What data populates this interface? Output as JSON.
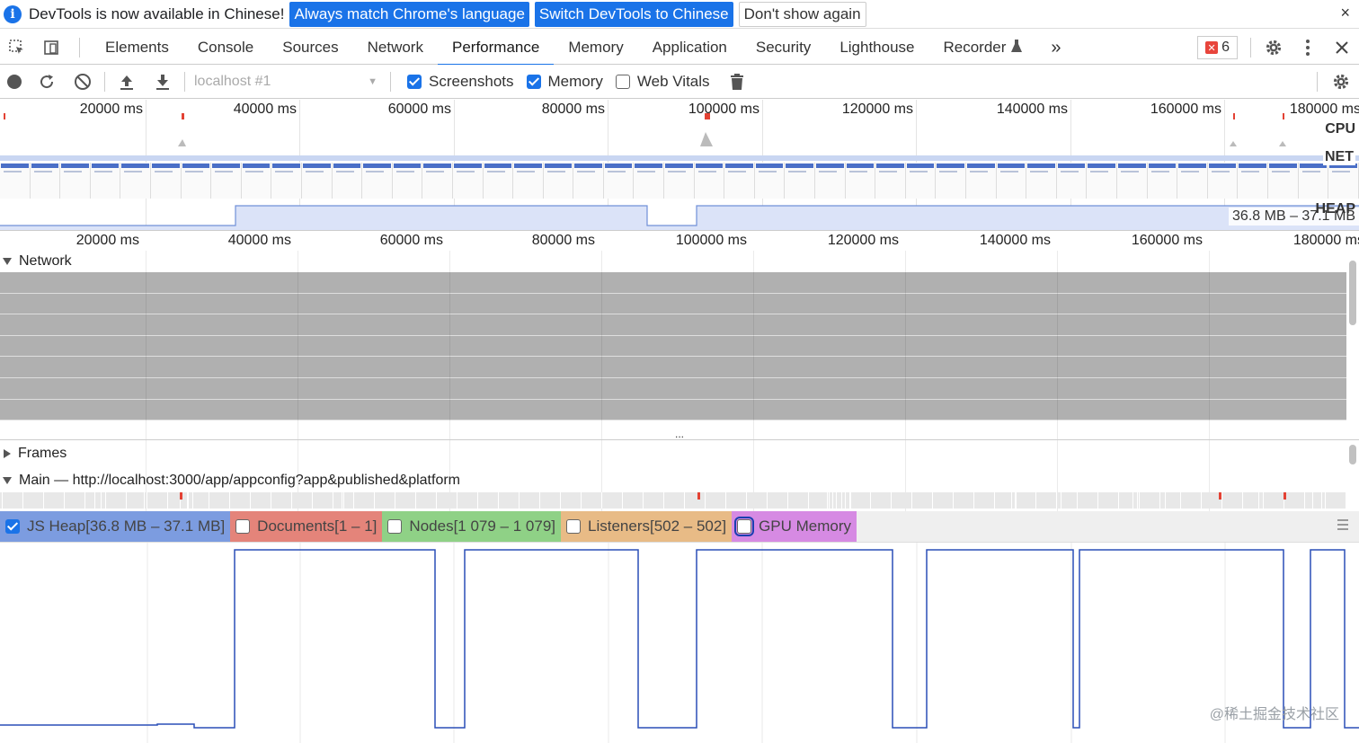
{
  "infobar": {
    "message": "DevTools is now available in Chinese!",
    "btn_match": "Always match Chrome's language",
    "btn_switch": "Switch DevTools to Chinese",
    "btn_dont_show": "Don't show again",
    "close": "×"
  },
  "tabs": [
    "Elements",
    "Console",
    "Sources",
    "Network",
    "Performance",
    "Memory",
    "Application",
    "Security",
    "Lighthouse",
    "Recorder"
  ],
  "active_tab": "Performance",
  "more_tabs": "»",
  "error_count": "6",
  "toolbar": {
    "profile_select": "localhost #1",
    "screenshots_label": "Screenshots",
    "memory_label": "Memory",
    "web_vitals_label": "Web Vitals"
  },
  "overview_ticks": [
    "20000 ms",
    "40000 ms",
    "60000 ms",
    "80000 ms",
    "100000 ms",
    "120000 ms",
    "140000 ms",
    "160000 ms",
    "180000 ms"
  ],
  "lane_labels": {
    "cpu": "CPU",
    "net": "NET",
    "heap": "HEAP"
  },
  "heap_range": "36.8 MB – 37.1 MB",
  "ruler_ticks": [
    "20000 ms",
    "40000 ms",
    "60000 ms",
    "80000 ms",
    "100000 ms",
    "120000 ms",
    "140000 ms",
    "160000 ms",
    "180000 ms"
  ],
  "tracks": {
    "network": "Network",
    "frames": "Frames",
    "main": "Main — http://localhost:3000/app/appconfig?app&published&platform"
  },
  "resizer": "...",
  "counters": [
    {
      "label": "JS Heap[36.8 MB – 37.1 MB]",
      "checked": true,
      "color": "#7c9ce0"
    },
    {
      "label": "Documents[1 – 1]",
      "checked": false,
      "color": "#e4847a"
    },
    {
      "label": "Nodes[1 079 – 1 079]",
      "checked": false,
      "color": "#8fd186"
    },
    {
      "label": "Listeners[502 – 502]",
      "checked": false,
      "color": "#e8bb86"
    },
    {
      "label": "GPU Memory",
      "checked": false,
      "color": "#d68ae3"
    }
  ],
  "colors": {
    "accent": "#1a73e8",
    "heap_line": "#2a4fb7"
  },
  "watermark": "@稀土掘金技术社区"
}
